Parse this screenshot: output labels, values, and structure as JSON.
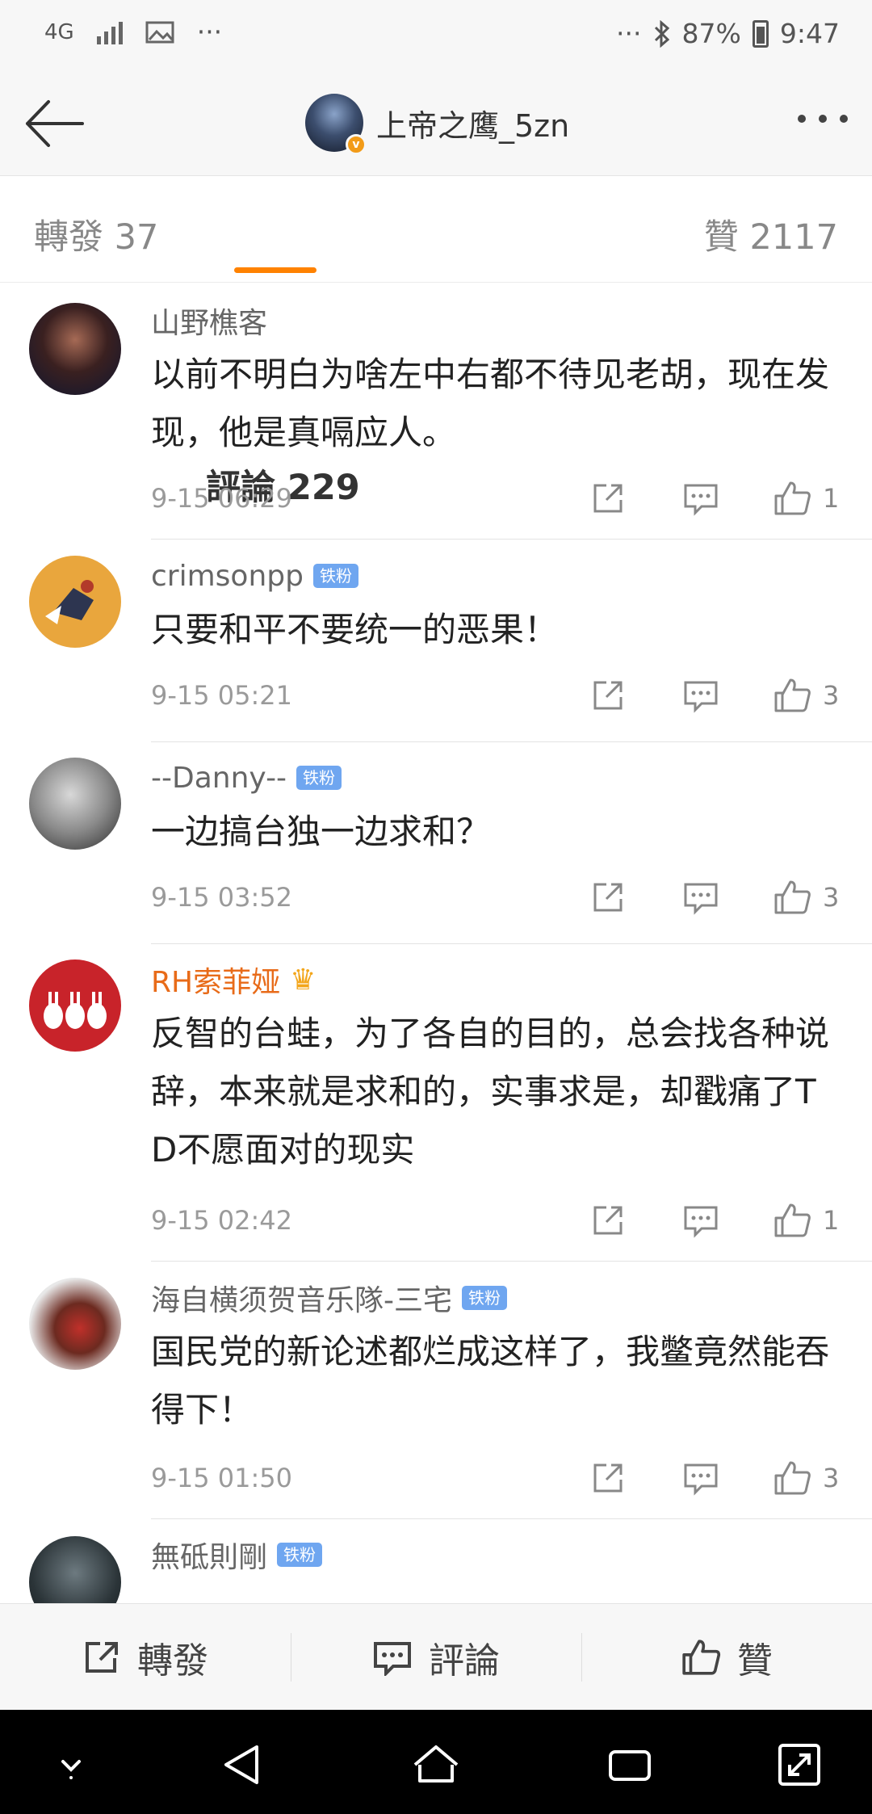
{
  "status": {
    "network": "4G",
    "battery": "87%",
    "time": "9:47",
    "dots": "···"
  },
  "header": {
    "title": "上帝之鹰_5zn",
    "verified": "v"
  },
  "tabs": {
    "repost": "轉發 37",
    "comments": "評論 229",
    "likes": "贊 2117"
  },
  "comments": [
    {
      "name": "山野樵客",
      "text": "以前不明白为啥左中右都不待见老胡，现在发现，他是真嗝应人。",
      "time": "9-15 06:29",
      "likes": "1"
    },
    {
      "name": "crimsonpp",
      "badge": "铁粉",
      "text": "只要和平不要统一的恶果！",
      "time": "9-15 05:21",
      "likes": "3"
    },
    {
      "name": "--Danny--",
      "badge": "铁粉",
      "text": "一边搞台独一边求和？",
      "time": "9-15 03:52",
      "likes": "3"
    },
    {
      "name": "RH索菲娅",
      "crown": "♛",
      "text": "反智的台蛙，为了各自的目的，总会找各种说辞，本来就是求和的，实事求是，却戳痛了TD不愿面对的现实",
      "time": "9-15 02:42",
      "likes": "1"
    },
    {
      "name": "海自横须贺音乐隊-三宅",
      "badge": "铁粉",
      "text": "国民党的新论述都烂成这样了，我鳖竟然能吞得下！",
      "time": "9-15 01:50",
      "likes": "3"
    },
    {
      "name": "無砥則剛",
      "badge": "铁粉"
    }
  ],
  "bottom_bar": {
    "repost": "轉發",
    "comment": "評論",
    "like": "贊"
  }
}
